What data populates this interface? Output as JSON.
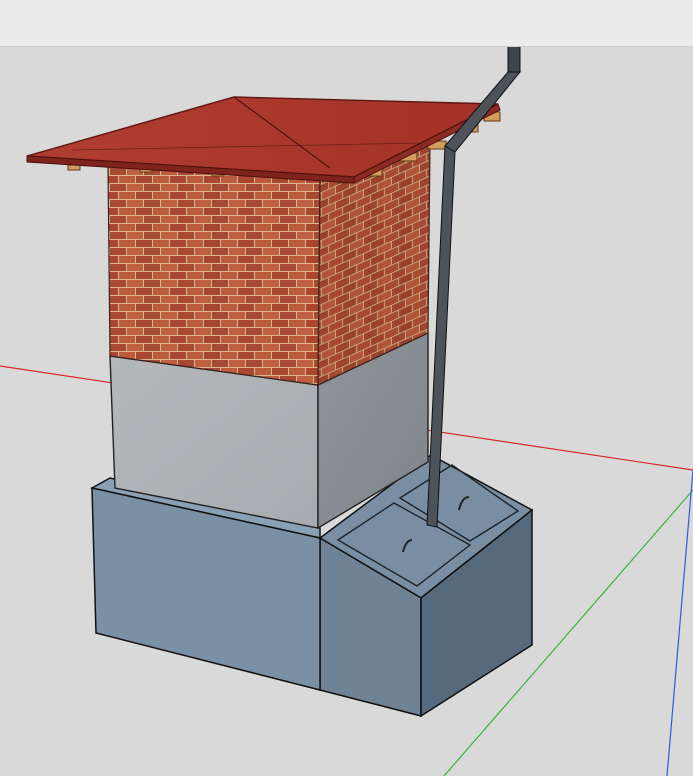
{
  "window": {
    "title": ""
  },
  "viewport": {
    "background": "#d9d9d9",
    "axes": {
      "red_axis_color": "#d42a2a",
      "green_axis_color": "#34b934",
      "blue_axis_color": "#2f5bd6"
    }
  },
  "model": {
    "roof_color": "#b53a2f",
    "roof_edge_color": "#7f231c",
    "brick_color": "#b24f36",
    "mortar_color": "#d7b78d",
    "concrete_color": "#aeb2b5",
    "base_color": "#6d7f92",
    "base_dark_color": "#56697d",
    "pipe_color": "#4d5359",
    "hatch_handle_color": "#1f2429"
  },
  "icons": {
    "downpipe": "downpipe-icon",
    "hatch_handle": "handle-icon"
  }
}
